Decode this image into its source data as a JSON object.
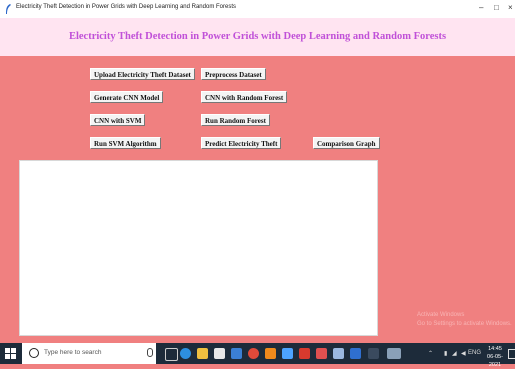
{
  "window": {
    "title": "Electricity Theft Detection in Power Grids with Deep Learning and Random Forests",
    "minimize_glyph": "–",
    "maximize_glyph": "□",
    "close_glyph": "×"
  },
  "header": {
    "title": "Electricity Theft Detection in Power Grids with Deep Learning and Random Forests"
  },
  "buttons": {
    "upload": "Upload Electricity Theft Dataset",
    "preprocess": "Preprocess Dataset",
    "generate_cnn": "Generate CNN Model",
    "cnn_rf": "CNN with Random Forest",
    "cnn_svm": "CNN with SVM",
    "run_rf": "Run Random Forest",
    "run_svm": "Run SVM Algorithm",
    "predict": "Predict Electricity Theft",
    "comparison": "Comparison Graph"
  },
  "output_text": "",
  "watermark": {
    "line1": "Activate Windows",
    "line2": "Go to Settings to activate Windows."
  },
  "taskbar": {
    "search_placeholder": "Type here to search",
    "icons": [
      "task-view-icon",
      "edge-icon",
      "file-explorer-icon",
      "store-icon",
      "mail-icon",
      "chrome-icon",
      "app-icon",
      "python-icon",
      "app-icon",
      "app-icon",
      "app-icon",
      "app-icon",
      "app-icon"
    ],
    "tray_symbols": "⌃",
    "language": "ENG",
    "time": "14:45",
    "date": "06-05-2021"
  },
  "colors": {
    "background": "#f08080",
    "header_background": "#ffe4f1",
    "title_text": "#c050d8",
    "taskbar": "#1d2b3a"
  }
}
